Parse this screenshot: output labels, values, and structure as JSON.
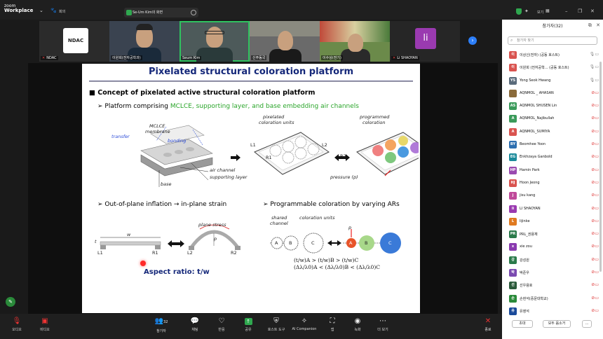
{
  "app": {
    "brand_small": "zoom",
    "brand": "Workplace"
  },
  "topbar": {
    "meeting_label": "회의",
    "share_chip": "Se-Um Kim의 화면",
    "window_view": "보기"
  },
  "gallery": [
    {
      "name": "NDAC",
      "muted": true
    },
    {
      "name": "이원희(전자공학과)",
      "muted": false
    },
    {
      "name": "Seum Kim",
      "muted": false
    },
    {
      "name": "신주동국",
      "muted": false
    },
    {
      "name": "이수상(전기)",
      "muted": false
    },
    {
      "name": "Li SHAOYAN",
      "muted": true
    }
  ],
  "ndac_logo": "NDAC",
  "li_avatar": "li",
  "slide": {
    "title": "Pixelated structural coloration platform",
    "bullet1": "Concept of pixelated active structural coloration platform",
    "bullet2_prefix": "Platform comprising ",
    "bullet2_green": "MCLCE, supporting layer, and base embedding air channels",
    "labels": {
      "mclce": "MCLCE",
      "membrane": "membrane",
      "transfer": "transfer",
      "bonding": "bonding",
      "air_channel": "air channel",
      "supporting_layer": "supporting layer",
      "base": "base",
      "pixelated": "pixelated",
      "coloration_units": "coloration units",
      "programmed": "programmed",
      "coloration": "coloration",
      "pressure": "pressure (p)",
      "l1": "L1",
      "r1": "R1",
      "l2": "L2",
      "r2": "R2",
      "t": "t",
      "w": "w",
      "p": "p",
      "plane_stress": "plane stress",
      "shared_channel_1": "shared",
      "shared_channel_2": "channel",
      "coloration_units_2": "coloration units",
      "a": "A",
      "b": "B",
      "c": "C"
    },
    "bullet3": "Out-of-plane inflation → in-plane strain",
    "bullet4": "Programmable coloration by varying ARs",
    "aspect_ratio": "Aspect ratio: t/w",
    "formula1": "(t/w)A > (t/w)B > (t/w)C",
    "formula2": "(Δλ/λ0)A < (Δλ/λ0)B < (Δλ/λ0)C"
  },
  "panel": {
    "title": "참가자(32)",
    "search_placeholder": "참가자 찾기",
    "participants": [
      {
        "initial": "이",
        "color": "#d9534f",
        "name": "이상신(전자) (공동 호스트)",
        "icon": "mic-video",
        "on": true
      },
      {
        "initial": "이",
        "color": "#d9534f",
        "name": "이원희 (전자공학... (공동 호스트)",
        "icon": "mic-video",
        "on": true
      },
      {
        "initial": "YS",
        "color": "#5a6b7b",
        "name": "Yong Seok Hwang",
        "icon": "mic-video",
        "on": true
      },
      {
        "initial": "",
        "color": "#8a6a3a",
        "name": "AQNMOL _ AHASAN",
        "icon": "muted",
        "on": false
      },
      {
        "initial": "AS",
        "color": "#3a9a5a",
        "name": "AQNMOL SHUSEN Lin",
        "icon": "muted",
        "on": false
      },
      {
        "initial": "A",
        "color": "#3a9a5a",
        "name": "AQNMOL_Najibullah",
        "icon": "muted",
        "on": false
      },
      {
        "initial": "A",
        "color": "#d9534f",
        "name": "AQNMOL_SUMIYA",
        "icon": "muted",
        "on": false
      },
      {
        "initial": "BY",
        "color": "#2d6fb0",
        "name": "Beomhee Yoon",
        "icon": "muted",
        "on": false
      },
      {
        "initial": "EG",
        "color": "#1a8a9a",
        "name": "Enkhzaya Ganbold",
        "icon": "muted",
        "on": false
      },
      {
        "initial": "HP",
        "color": "#9a4ab0",
        "name": "Hamin Park",
        "icon": "muted",
        "on": false
      },
      {
        "initial": "HJ",
        "color": "#d9534f",
        "name": "Hoon Jeong",
        "icon": "muted",
        "on": false
      },
      {
        "initial": "j",
        "color": "#c04a9a",
        "name": "jisu kang",
        "icon": "muted",
        "on": false
      },
      {
        "initial": "li",
        "color": "#9a3ab0",
        "name": "LI SHAOYAN",
        "icon": "muted",
        "on": false
      },
      {
        "initial": "L",
        "color": "#e07a20",
        "name": "lijinke",
        "icon": "muted",
        "on": false
      },
      {
        "initial": "PR",
        "color": "#2a7a4a",
        "name": "PRL_권용재",
        "icon": "muted",
        "on": false
      },
      {
        "initial": "x",
        "color": "#8a3ab0",
        "name": "xie zou",
        "icon": "muted",
        "on": false
      },
      {
        "initial": "강",
        "color": "#2a7a4a",
        "name": "강성원",
        "icon": "muted",
        "on": false
      },
      {
        "initial": "박",
        "color": "#7a4ab0",
        "name": "박준우",
        "icon": "muted",
        "on": false
      },
      {
        "initial": "선",
        "color": "#2a5a3a",
        "name": "선우용호",
        "icon": "muted",
        "on": false
      },
      {
        "initial": "손",
        "color": "#2a8a3a",
        "name": "손현석(중문대학교)",
        "icon": "muted",
        "on": false
      },
      {
        "initial": "유",
        "color": "#1a4a9a",
        "name": "유영석",
        "icon": "muted",
        "on": false
      }
    ],
    "invite": "초대",
    "mute_all": "모두 음소거",
    "more": "..."
  },
  "toolbar": {
    "audio": "오디오",
    "video": "비디오",
    "participants": "참가자",
    "participants_count": "32",
    "chat": "채팅",
    "react": "반응",
    "share": "공유",
    "host_tools": "호스트 도구",
    "ai_companion": "AI Companion",
    "apps": "앱",
    "record": "녹화",
    "more": "더 보기",
    "end": "종료"
  }
}
